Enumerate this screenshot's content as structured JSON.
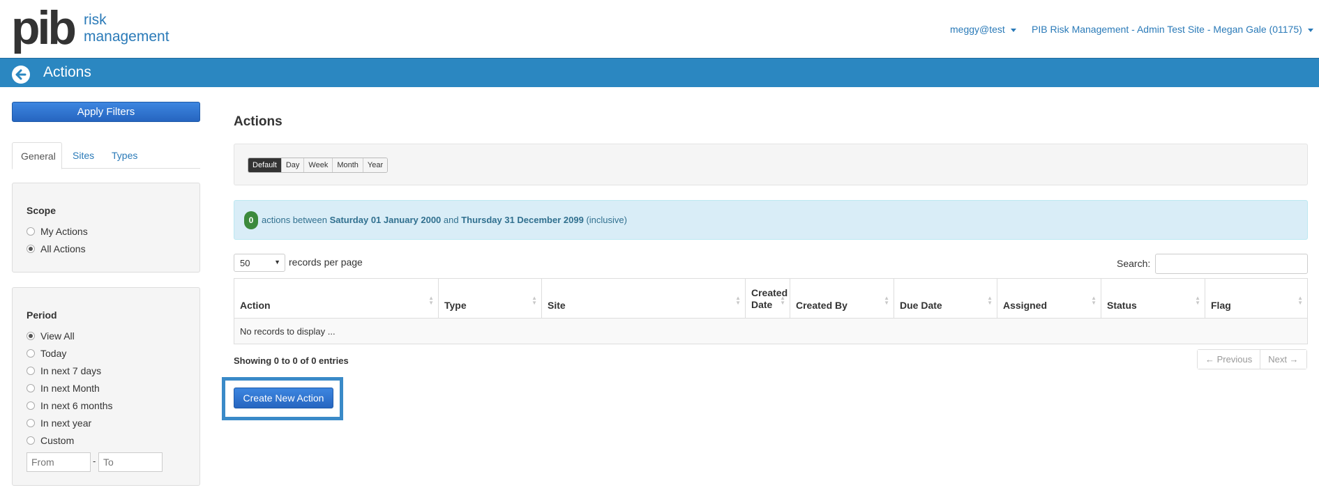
{
  "header": {
    "logo_main": "pib",
    "logo_line1": "risk",
    "logo_line2": "management",
    "user": "meggy@test",
    "site": "PIB Risk Management - Admin Test Site - Megan Gale (01175)"
  },
  "titlebar": {
    "title": "Actions"
  },
  "sidebar": {
    "apply_label": "Apply Filters",
    "tabs": [
      {
        "label": "General",
        "active": true
      },
      {
        "label": "Sites",
        "active": false
      },
      {
        "label": "Types",
        "active": false
      }
    ],
    "scope": {
      "title": "Scope",
      "options": [
        {
          "label": "My Actions",
          "selected": false
        },
        {
          "label": "All Actions",
          "selected": true
        }
      ]
    },
    "period": {
      "title": "Period",
      "options": [
        {
          "label": "View All",
          "selected": true
        },
        {
          "label": "Today",
          "selected": false
        },
        {
          "label": "In next 7 days",
          "selected": false
        },
        {
          "label": "In next Month",
          "selected": false
        },
        {
          "label": "In next 6 months",
          "selected": false
        },
        {
          "label": "In next year",
          "selected": false
        },
        {
          "label": "Custom",
          "selected": false
        }
      ],
      "from_placeholder": "From",
      "to_placeholder": "To",
      "separator": "-"
    }
  },
  "main": {
    "title": "Actions",
    "range_buttons": [
      {
        "label": "Default",
        "active": true
      },
      {
        "label": "Day",
        "active": false
      },
      {
        "label": "Week",
        "active": false
      },
      {
        "label": "Month",
        "active": false
      },
      {
        "label": "Year",
        "active": false
      }
    ],
    "info": {
      "count": "0",
      "text1": " actions between ",
      "start": "Saturday 01 January 2000",
      "text2": " and ",
      "end": "Thursday 31 December 2099",
      "text3": " (inclusive)"
    },
    "records_per_page": "50",
    "records_label": "records per page",
    "search_label": "Search:",
    "table": {
      "columns": [
        "Action",
        "Type",
        "Site",
        "Created Date",
        "Created By",
        "Due Date",
        "Assigned",
        "Status",
        "Flag"
      ],
      "empty_message": "No records to display ..."
    },
    "showing": "Showing 0 to 0 of 0 entries",
    "pager": {
      "previous": "← Previous",
      "next": "Next →"
    },
    "create_label": "Create New Action"
  },
  "colors": {
    "brand_blue": "#2b87c1",
    "button_blue": "#2f74d0",
    "badge_green": "#3c8a3c",
    "info_bg": "#d9edf7"
  }
}
